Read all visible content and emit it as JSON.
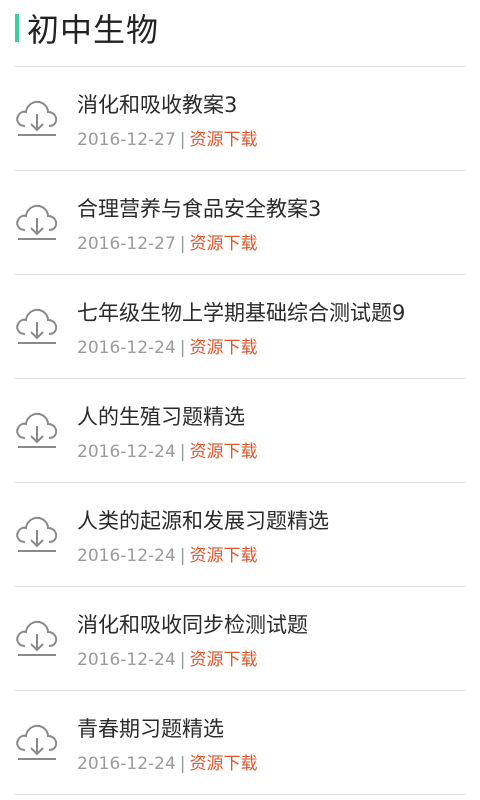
{
  "header": {
    "title": "初中生物",
    "accent_color": "#3ccf9b"
  },
  "items": [
    {
      "title": "消化和吸收教案3",
      "date": "2016-12-27",
      "link": "资源下载",
      "icon": "cloud-download-icon"
    },
    {
      "title": "合理营养与食品安全教案3",
      "date": "2016-12-27",
      "link": "资源下载",
      "icon": "cloud-download-icon"
    },
    {
      "title": "七年级生物上学期基础综合测试题9",
      "date": "2016-12-24",
      "link": "资源下载",
      "icon": "cloud-download-icon"
    },
    {
      "title": "人的生殖习题精选",
      "date": "2016-12-24",
      "link": "资源下载",
      "icon": "cloud-download-icon"
    },
    {
      "title": "人类的起源和发展习题精选",
      "date": "2016-12-24",
      "link": "资源下载",
      "icon": "cloud-download-icon"
    },
    {
      "title": "消化和吸收同步检测试题",
      "date": "2016-12-24",
      "link": "资源下载",
      "icon": "cloud-download-icon"
    },
    {
      "title": "青春期习题精选",
      "date": "2016-12-24",
      "link": "资源下载",
      "icon": "cloud-download-icon"
    }
  ],
  "separator": "|",
  "link_color": "#e2542a"
}
